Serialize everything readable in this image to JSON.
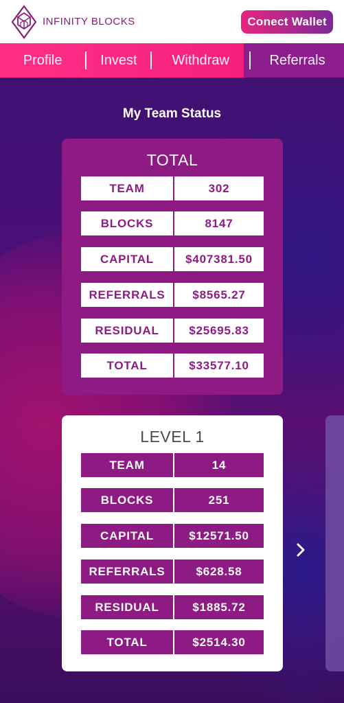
{
  "header": {
    "brand": "INFINITY BLOCKS",
    "wallet_button": "Conect Wallet"
  },
  "nav": {
    "tabs": [
      {
        "label": "Profile"
      },
      {
        "label": "Invest"
      },
      {
        "label": "Withdraw"
      },
      {
        "label": "Referrals"
      }
    ]
  },
  "page": {
    "title": "My Team Status"
  },
  "total_card": {
    "heading": "TOTAL",
    "rows": [
      {
        "label": "TEAM",
        "value": "302"
      },
      {
        "label": "BLOCKS",
        "value": "8147"
      },
      {
        "label": "CAPITAL",
        "value": "$407381.50"
      },
      {
        "label": "REFERRALS",
        "value": "$8565.27"
      },
      {
        "label": "RESIDUAL",
        "value": "$25695.83"
      },
      {
        "label": "TOTAL",
        "value": "$33577.10"
      }
    ]
  },
  "level_card": {
    "heading": "LEVEL 1",
    "rows": [
      {
        "label": "TEAM",
        "value": "14"
      },
      {
        "label": "BLOCKS",
        "value": "251"
      },
      {
        "label": "CAPITAL",
        "value": "$12571.50"
      },
      {
        "label": "REFERRALS",
        "value": "$628.58"
      },
      {
        "label": "RESIDUAL",
        "value": "$1885.72"
      },
      {
        "label": "TOTAL",
        "value": "$2514.30"
      }
    ]
  },
  "icons": {
    "logo": "infinity-blocks-logo",
    "next": "chevron-right-icon"
  },
  "colors": {
    "brand_purple": "#8d1b83",
    "nav_pink": "#ff2f86",
    "accent_gradient_start": "#e7257f",
    "accent_gradient_end": "#7b2a96"
  }
}
